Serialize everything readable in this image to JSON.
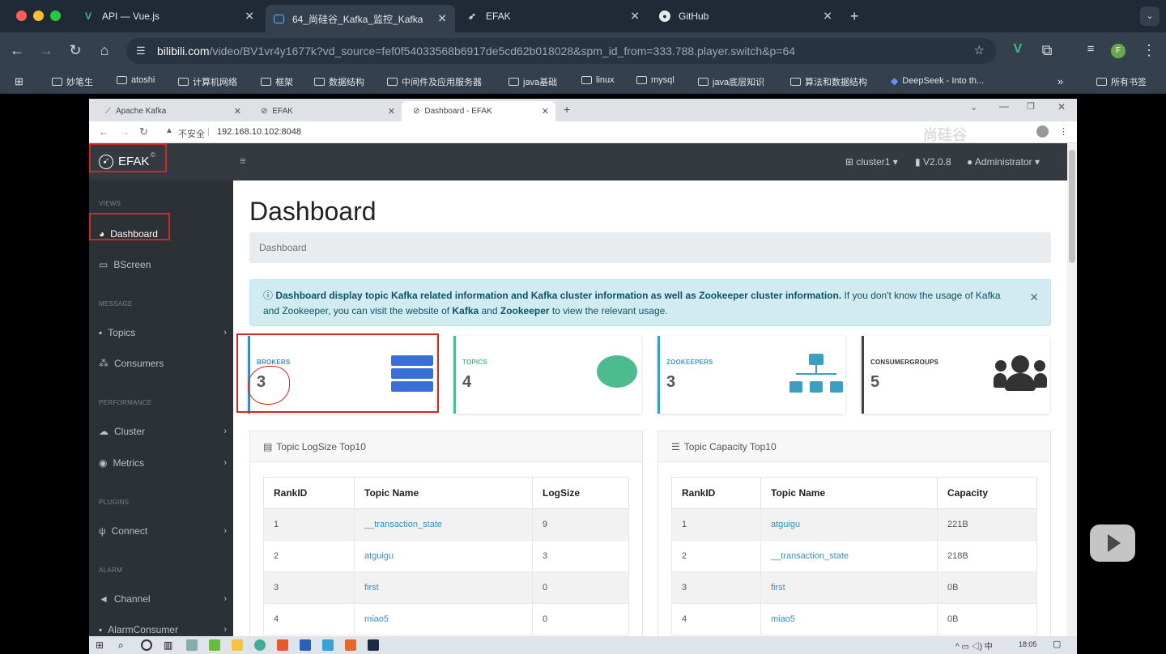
{
  "browser": {
    "tabs": [
      {
        "title": "API — Vue.js",
        "icon": "vue-icon"
      },
      {
        "title": "64_尚硅谷_Kafka_监控_Kafka",
        "icon": "bilibili-icon"
      },
      {
        "title": "EFAK",
        "icon": "efak-icon"
      },
      {
        "title": "GitHub",
        "icon": "github-icon"
      }
    ],
    "url_host": "bilibili.com",
    "url_path": "/video/BV1vr4y1677k?vd_source=fef0f54033568b6917de5cd62b018028&spm_id_from=333.788.player.switch&p=64",
    "profile_initial": "F",
    "bookmarks": [
      "妙笔生",
      "atoshi",
      "计算机网络",
      "框架",
      "数据结构",
      "中间件及应用服务器",
      "java基础",
      "linux",
      "mysql",
      "java底层知识",
      "算法和数据结构",
      "DeepSeek - Into th..."
    ],
    "all_bookmarks": "所有书签"
  },
  "inner_browser": {
    "tabs": [
      "Apache Kafka",
      "EFAK",
      "Dashboard - EFAK"
    ],
    "insecure_label": "不安全",
    "address": "192.168.10.102:8048",
    "watermark": "尚硅谷"
  },
  "app": {
    "brand": "EFAK",
    "cluster": "cluster1",
    "version": "V2.0.8",
    "user": "Administrator"
  },
  "sidebar": {
    "sections": [
      {
        "header": "VIEWS",
        "items": [
          {
            "label": "Dashboard",
            "icon": "dashboard-icon"
          },
          {
            "label": "BScreen",
            "icon": "monitor-icon"
          }
        ]
      },
      {
        "header": "MESSAGE",
        "items": [
          {
            "label": "Topics",
            "icon": "message-icon"
          },
          {
            "label": "Consumers",
            "icon": "users-icon"
          }
        ]
      },
      {
        "header": "PERFORMANCE",
        "items": [
          {
            "label": "Cluster",
            "icon": "cloud-icon"
          },
          {
            "label": "Metrics",
            "icon": "eye-icon"
          }
        ]
      },
      {
        "header": "PLUGINS",
        "items": [
          {
            "label": "Connect",
            "icon": "plug-icon"
          }
        ]
      },
      {
        "header": "ALARM",
        "items": [
          {
            "label": "Channel",
            "icon": "bullhorn-icon"
          },
          {
            "label": "AlarmConsumer",
            "icon": "bell-icon"
          }
        ]
      }
    ]
  },
  "page": {
    "title": "Dashboard",
    "breadcrumb": "Dashboard",
    "alert_bold": "Dashboard display topic Kafka related information and Kafka cluster information as well as Zookeeper cluster information.",
    "alert_text1": " If you don't know the usage of Kafka and Zookeeper, you can visit the website of ",
    "alert_kafka": "Kafka",
    "alert_and": " and ",
    "alert_zk": "Zookeeper",
    "alert_text2": " to view the relevant usage."
  },
  "cards": [
    {
      "label": "BROKERS",
      "value": "3",
      "color": "#3c8dbc"
    },
    {
      "label": "TOPICS",
      "value": "4",
      "color": "#4cbb8d"
    },
    {
      "label": "ZOOKEEPERS",
      "value": "3",
      "color": "#3c9fc2"
    },
    {
      "label": "CONSUMERGROUPS",
      "value": "5",
      "color": "#444444"
    }
  ],
  "logsize_panel": {
    "title": "Topic LogSize Top10",
    "headers": [
      "RankID",
      "Topic Name",
      "LogSize"
    ],
    "rows": [
      [
        "1",
        "__transaction_state",
        "9"
      ],
      [
        "2",
        "atguigu",
        "3"
      ],
      [
        "3",
        "first",
        "0"
      ],
      [
        "4",
        "miao5",
        "0"
      ]
    ]
  },
  "capacity_panel": {
    "title": "Topic Capacity Top10",
    "headers": [
      "RankID",
      "Topic Name",
      "Capacity"
    ],
    "rows": [
      [
        "1",
        "atguigu",
        "221B"
      ],
      [
        "2",
        "__transaction_state",
        "218B"
      ],
      [
        "3",
        "first",
        "0B"
      ],
      [
        "4",
        "miao5",
        "0B"
      ]
    ]
  },
  "taskbar": {
    "time": "18:05"
  }
}
